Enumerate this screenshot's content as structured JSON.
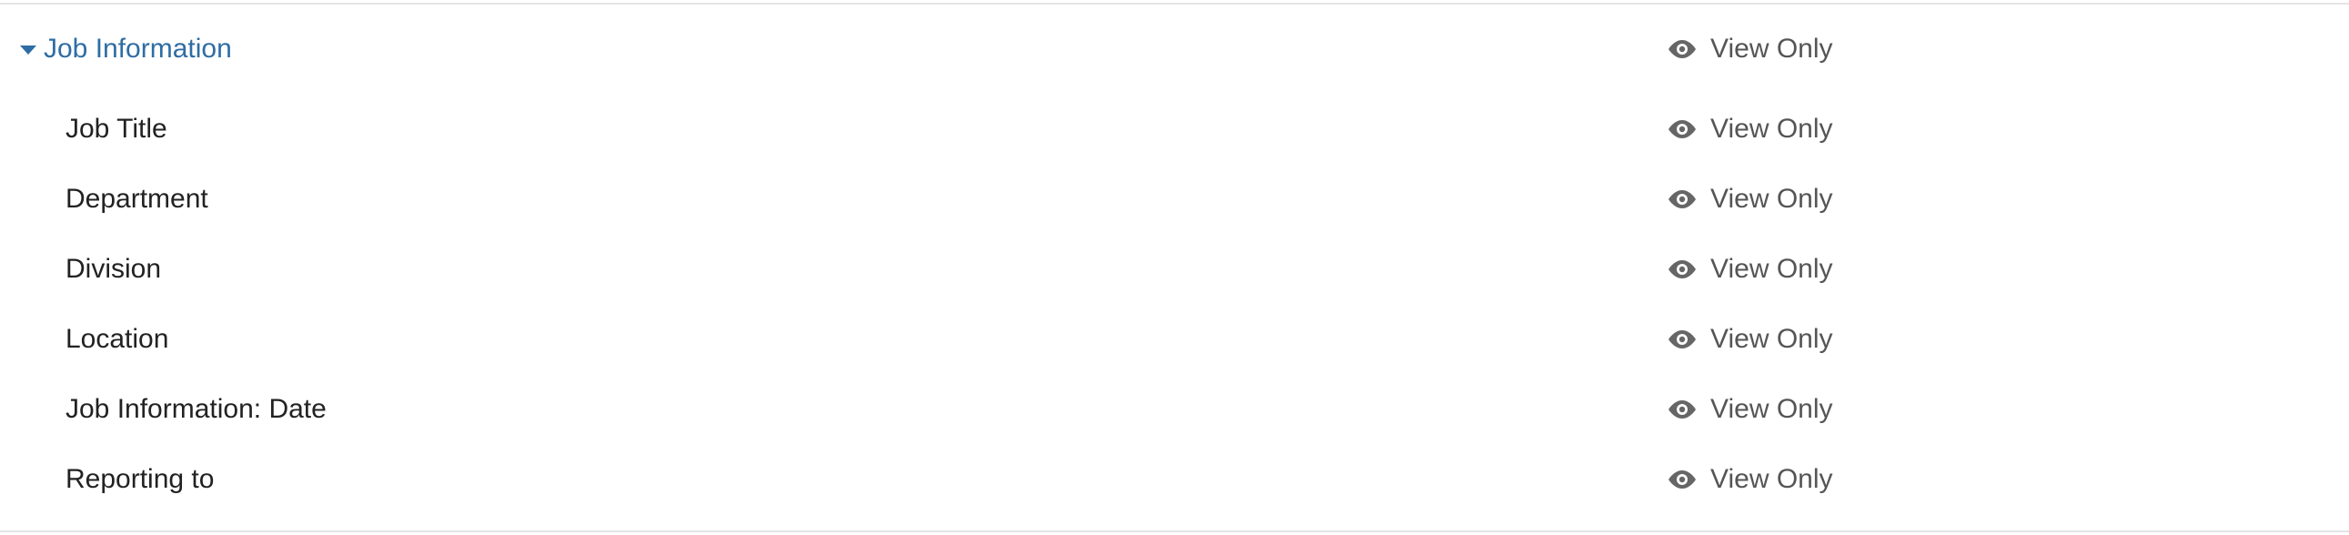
{
  "section": {
    "title": "Job Information",
    "access_label": "View Only",
    "access_icon": "eye-icon",
    "collapse_icon": "caret-down-icon"
  },
  "fields": [
    {
      "label": "Job Title",
      "access_label": "View Only"
    },
    {
      "label": "Department",
      "access_label": "View Only"
    },
    {
      "label": "Division",
      "access_label": "View Only"
    },
    {
      "label": "Location",
      "access_label": "View Only"
    },
    {
      "label": "Job Information: Date",
      "access_label": "View Only"
    },
    {
      "label": "Reporting to",
      "access_label": "View Only"
    }
  ],
  "colors": {
    "section_title": "#2e6da4",
    "field_label": "#222222",
    "access_text": "#555555",
    "eye_icon": "#666666",
    "divider": "#e4e4e4"
  }
}
